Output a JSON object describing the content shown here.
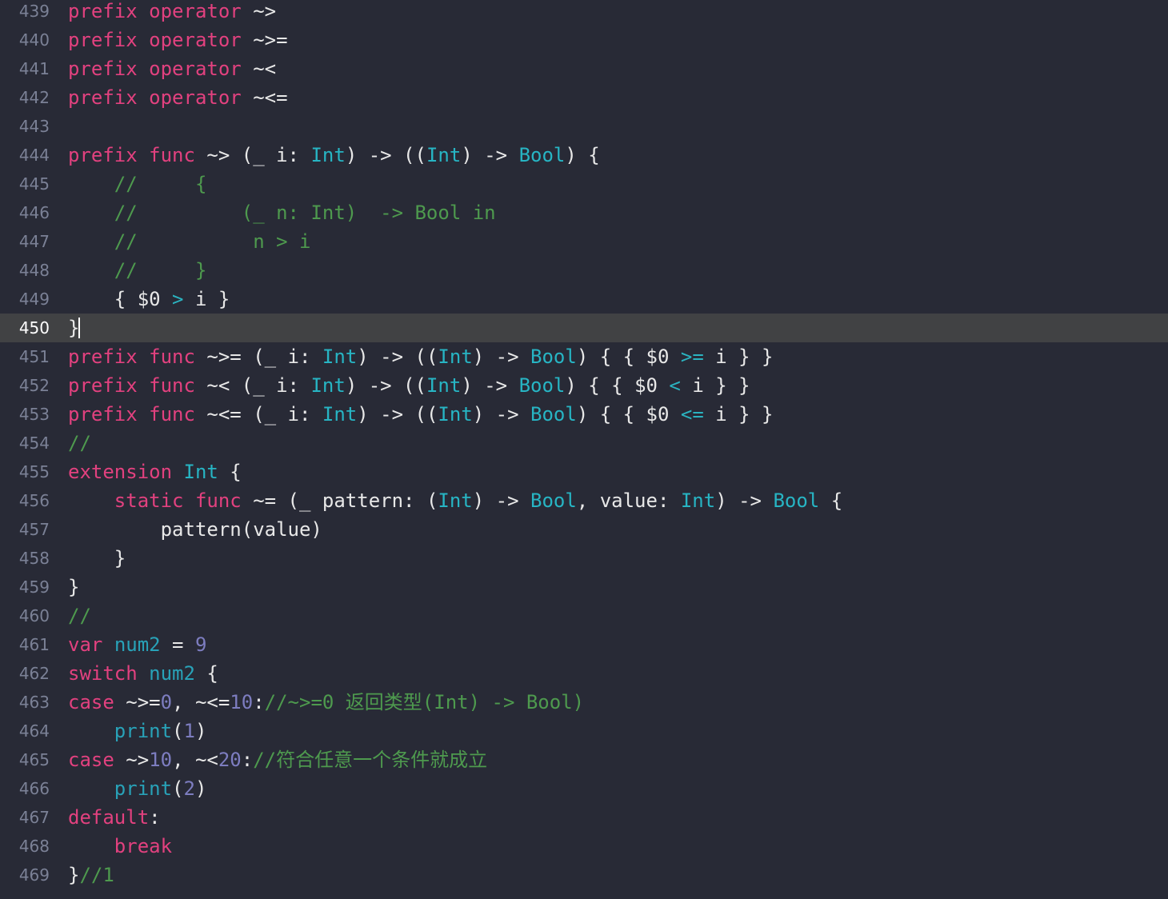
{
  "editor": {
    "theme": {
      "background": "#282a36",
      "active_line_background": "#414244",
      "gutter_color": "#7b8196",
      "gutter_active_color": "#ffffff",
      "keyword": "#e2417f",
      "type": "#27b5c4",
      "function": "#28a2b8",
      "number": "#7d7dc0",
      "comment": "#4e9a4e",
      "operator": "#2bb3c0",
      "plain": "#e8e8e8",
      "cursor": "#ffffff"
    },
    "language": "Swift",
    "active_line": 450,
    "first_visible_line": 439,
    "last_visible_line": 469,
    "lines": [
      {
        "number": "439",
        "active": false,
        "tokens": [
          {
            "t": "prefix",
            "c": "kw"
          },
          {
            "t": " ",
            "c": "pln"
          },
          {
            "t": "operator",
            "c": "kw"
          },
          {
            "t": " ~>",
            "c": "pln"
          }
        ]
      },
      {
        "number": "440",
        "active": false,
        "tokens": [
          {
            "t": "prefix",
            "c": "kw"
          },
          {
            "t": " ",
            "c": "pln"
          },
          {
            "t": "operator",
            "c": "kw"
          },
          {
            "t": " ~>=",
            "c": "pln"
          }
        ]
      },
      {
        "number": "441",
        "active": false,
        "tokens": [
          {
            "t": "prefix",
            "c": "kw"
          },
          {
            "t": " ",
            "c": "pln"
          },
          {
            "t": "operator",
            "c": "kw"
          },
          {
            "t": " ~<",
            "c": "pln"
          }
        ]
      },
      {
        "number": "442",
        "active": false,
        "tokens": [
          {
            "t": "prefix",
            "c": "kw"
          },
          {
            "t": " ",
            "c": "pln"
          },
          {
            "t": "operator",
            "c": "kw"
          },
          {
            "t": " ~<=",
            "c": "pln"
          }
        ]
      },
      {
        "number": "443",
        "active": false,
        "tokens": []
      },
      {
        "number": "444",
        "active": false,
        "tokens": [
          {
            "t": "prefix",
            "c": "kw"
          },
          {
            "t": " ",
            "c": "pln"
          },
          {
            "t": "func",
            "c": "kw"
          },
          {
            "t": " ~> (_ i: ",
            "c": "pln"
          },
          {
            "t": "Int",
            "c": "typ"
          },
          {
            "t": ") -> ((",
            "c": "pln"
          },
          {
            "t": "Int",
            "c": "typ"
          },
          {
            "t": ") -> ",
            "c": "pln"
          },
          {
            "t": "Bool",
            "c": "typ"
          },
          {
            "t": ") {",
            "c": "pln"
          }
        ]
      },
      {
        "number": "445",
        "active": false,
        "tokens": [
          {
            "t": "    //     {",
            "c": "cmt"
          }
        ]
      },
      {
        "number": "446",
        "active": false,
        "tokens": [
          {
            "t": "    //         (_ n: Int)  -> Bool in",
            "c": "cmt"
          }
        ]
      },
      {
        "number": "447",
        "active": false,
        "tokens": [
          {
            "t": "    //          n > i",
            "c": "cmt"
          }
        ]
      },
      {
        "number": "448",
        "active": false,
        "tokens": [
          {
            "t": "    //     }",
            "c": "cmt"
          }
        ]
      },
      {
        "number": "449",
        "active": false,
        "tokens": [
          {
            "t": "    { $0 ",
            "c": "pln"
          },
          {
            "t": ">",
            "c": "op"
          },
          {
            "t": " i }",
            "c": "pln"
          }
        ]
      },
      {
        "number": "450",
        "active": true,
        "cursor": true,
        "tokens": [
          {
            "t": "}",
            "c": "pln"
          }
        ]
      },
      {
        "number": "451",
        "active": false,
        "tokens": [
          {
            "t": "prefix",
            "c": "kw"
          },
          {
            "t": " ",
            "c": "pln"
          },
          {
            "t": "func",
            "c": "kw"
          },
          {
            "t": " ~>= (_ i: ",
            "c": "pln"
          },
          {
            "t": "Int",
            "c": "typ"
          },
          {
            "t": ") -> ((",
            "c": "pln"
          },
          {
            "t": "Int",
            "c": "typ"
          },
          {
            "t": ") -> ",
            "c": "pln"
          },
          {
            "t": "Bool",
            "c": "typ"
          },
          {
            "t": ") { { $0 ",
            "c": "pln"
          },
          {
            "t": ">=",
            "c": "op"
          },
          {
            "t": " i } }",
            "c": "pln"
          }
        ]
      },
      {
        "number": "452",
        "active": false,
        "tokens": [
          {
            "t": "prefix",
            "c": "kw"
          },
          {
            "t": " ",
            "c": "pln"
          },
          {
            "t": "func",
            "c": "kw"
          },
          {
            "t": " ~< (_ i: ",
            "c": "pln"
          },
          {
            "t": "Int",
            "c": "typ"
          },
          {
            "t": ") -> ((",
            "c": "pln"
          },
          {
            "t": "Int",
            "c": "typ"
          },
          {
            "t": ") -> ",
            "c": "pln"
          },
          {
            "t": "Bool",
            "c": "typ"
          },
          {
            "t": ") { { $0 ",
            "c": "pln"
          },
          {
            "t": "<",
            "c": "op"
          },
          {
            "t": " i } }",
            "c": "pln"
          }
        ]
      },
      {
        "number": "453",
        "active": false,
        "tokens": [
          {
            "t": "prefix",
            "c": "kw"
          },
          {
            "t": " ",
            "c": "pln"
          },
          {
            "t": "func",
            "c": "kw"
          },
          {
            "t": " ~<= (_ i: ",
            "c": "pln"
          },
          {
            "t": "Int",
            "c": "typ"
          },
          {
            "t": ") -> ((",
            "c": "pln"
          },
          {
            "t": "Int",
            "c": "typ"
          },
          {
            "t": ") -> ",
            "c": "pln"
          },
          {
            "t": "Bool",
            "c": "typ"
          },
          {
            "t": ") { { $0 ",
            "c": "pln"
          },
          {
            "t": "<=",
            "c": "op"
          },
          {
            "t": " i } }",
            "c": "pln"
          }
        ]
      },
      {
        "number": "454",
        "active": false,
        "tokens": [
          {
            "t": "//",
            "c": "cmt"
          }
        ]
      },
      {
        "number": "455",
        "active": false,
        "tokens": [
          {
            "t": "extension",
            "c": "kw"
          },
          {
            "t": " ",
            "c": "pln"
          },
          {
            "t": "Int",
            "c": "typ"
          },
          {
            "t": " {",
            "c": "pln"
          }
        ]
      },
      {
        "number": "456",
        "active": false,
        "tokens": [
          {
            "t": "    ",
            "c": "pln"
          },
          {
            "t": "static",
            "c": "kw"
          },
          {
            "t": " ",
            "c": "pln"
          },
          {
            "t": "func",
            "c": "kw"
          },
          {
            "t": " ~= (_ pattern: (",
            "c": "pln"
          },
          {
            "t": "Int",
            "c": "typ"
          },
          {
            "t": ") -> ",
            "c": "pln"
          },
          {
            "t": "Bool",
            "c": "typ"
          },
          {
            "t": ", value: ",
            "c": "pln"
          },
          {
            "t": "Int",
            "c": "typ"
          },
          {
            "t": ") -> ",
            "c": "pln"
          },
          {
            "t": "Bool",
            "c": "typ"
          },
          {
            "t": " {",
            "c": "pln"
          }
        ]
      },
      {
        "number": "457",
        "active": false,
        "tokens": [
          {
            "t": "        pattern(value)",
            "c": "pln"
          }
        ]
      },
      {
        "number": "458",
        "active": false,
        "tokens": [
          {
            "t": "    }",
            "c": "pln"
          }
        ]
      },
      {
        "number": "459",
        "active": false,
        "tokens": [
          {
            "t": "}",
            "c": "pln"
          }
        ]
      },
      {
        "number": "460",
        "active": false,
        "tokens": [
          {
            "t": "//",
            "c": "cmt"
          }
        ]
      },
      {
        "number": "461",
        "active": false,
        "tokens": [
          {
            "t": "var",
            "c": "kw"
          },
          {
            "t": " ",
            "c": "pln"
          },
          {
            "t": "num2",
            "c": "fn"
          },
          {
            "t": " = ",
            "c": "pln"
          },
          {
            "t": "9",
            "c": "num"
          }
        ]
      },
      {
        "number": "462",
        "active": false,
        "tokens": [
          {
            "t": "switch",
            "c": "kw"
          },
          {
            "t": " ",
            "c": "pln"
          },
          {
            "t": "num2",
            "c": "fn"
          },
          {
            "t": " {",
            "c": "pln"
          }
        ]
      },
      {
        "number": "463",
        "active": false,
        "tokens": [
          {
            "t": "case",
            "c": "kw"
          },
          {
            "t": " ~>=",
            "c": "pln"
          },
          {
            "t": "0",
            "c": "num"
          },
          {
            "t": ", ~<=",
            "c": "pln"
          },
          {
            "t": "10",
            "c": "num"
          },
          {
            "t": ":",
            "c": "pln"
          },
          {
            "t": "//~>=0 返回类型(Int) -> Bool)",
            "c": "cmt"
          }
        ]
      },
      {
        "number": "464",
        "active": false,
        "tokens": [
          {
            "t": "    ",
            "c": "pln"
          },
          {
            "t": "print",
            "c": "fn"
          },
          {
            "t": "(",
            "c": "pln"
          },
          {
            "t": "1",
            "c": "num"
          },
          {
            "t": ")",
            "c": "pln"
          }
        ]
      },
      {
        "number": "465",
        "active": false,
        "tokens": [
          {
            "t": "case",
            "c": "kw"
          },
          {
            "t": " ~>",
            "c": "pln"
          },
          {
            "t": "10",
            "c": "num"
          },
          {
            "t": ", ~<",
            "c": "pln"
          },
          {
            "t": "20",
            "c": "num"
          },
          {
            "t": ":",
            "c": "pln"
          },
          {
            "t": "//符合任意一个条件就成立",
            "c": "cmt"
          }
        ]
      },
      {
        "number": "466",
        "active": false,
        "tokens": [
          {
            "t": "    ",
            "c": "pln"
          },
          {
            "t": "print",
            "c": "fn"
          },
          {
            "t": "(",
            "c": "pln"
          },
          {
            "t": "2",
            "c": "num"
          },
          {
            "t": ")",
            "c": "pln"
          }
        ]
      },
      {
        "number": "467",
        "active": false,
        "tokens": [
          {
            "t": "default",
            "c": "kw"
          },
          {
            "t": ":",
            "c": "pln"
          }
        ]
      },
      {
        "number": "468",
        "active": false,
        "tokens": [
          {
            "t": "    ",
            "c": "pln"
          },
          {
            "t": "break",
            "c": "kw"
          }
        ]
      },
      {
        "number": "469",
        "active": false,
        "tokens": [
          {
            "t": "}",
            "c": "pln"
          },
          {
            "t": "//1",
            "c": "cmt"
          }
        ]
      }
    ]
  }
}
